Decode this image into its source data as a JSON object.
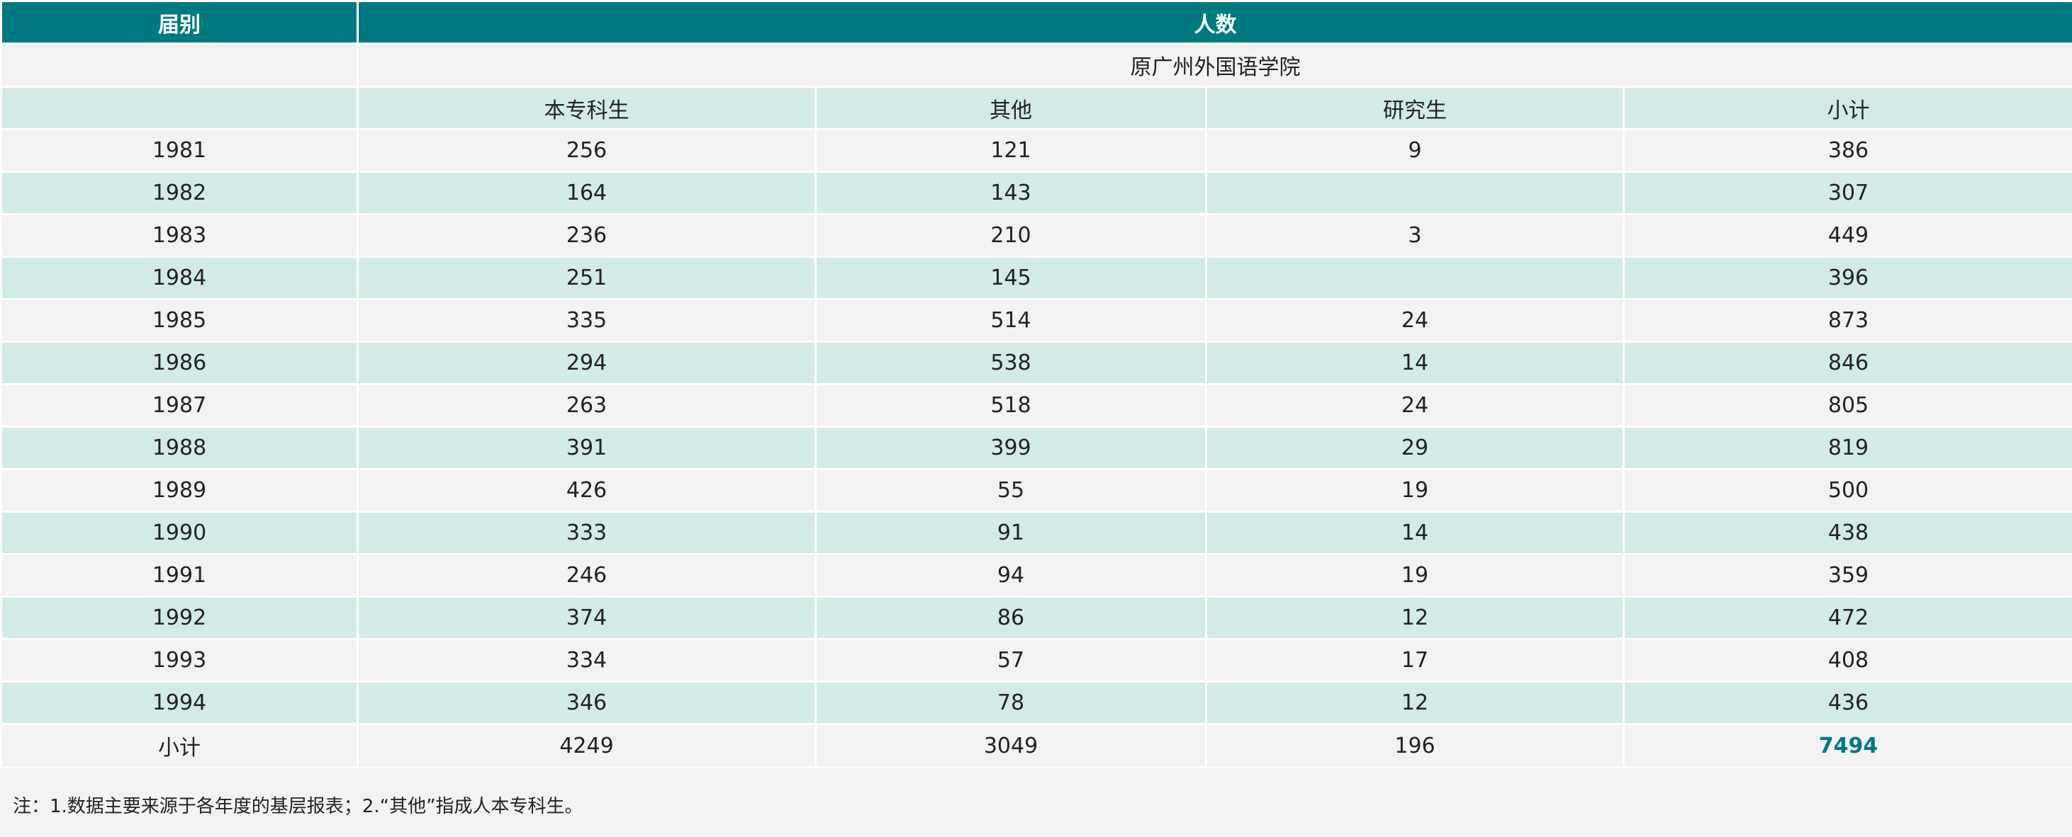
{
  "header": {
    "col_term": "届别",
    "col_count": "人数"
  },
  "band": {
    "school": "原广州外国语学院"
  },
  "subheader": {
    "undergrad": "本专科生",
    "other": "其他",
    "graduate": "研究生",
    "subtotal": "小计"
  },
  "rows": [
    {
      "year": "1981",
      "undergrad": "256",
      "other": "121",
      "graduate": "9",
      "subtotal": "386"
    },
    {
      "year": "1982",
      "undergrad": "164",
      "other": "143",
      "graduate": "",
      "subtotal": "307"
    },
    {
      "year": "1983",
      "undergrad": "236",
      "other": "210",
      "graduate": "3",
      "subtotal": "449"
    },
    {
      "year": "1984",
      "undergrad": "251",
      "other": "145",
      "graduate": "",
      "subtotal": "396"
    },
    {
      "year": "1985",
      "undergrad": "335",
      "other": "514",
      "graduate": "24",
      "subtotal": "873"
    },
    {
      "year": "1986",
      "undergrad": "294",
      "other": "538",
      "graduate": "14",
      "subtotal": "846"
    },
    {
      "year": "1987",
      "undergrad": "263",
      "other": "518",
      "graduate": "24",
      "subtotal": "805"
    },
    {
      "year": "1988",
      "undergrad": "391",
      "other": "399",
      "graduate": "29",
      "subtotal": "819"
    },
    {
      "year": "1989",
      "undergrad": "426",
      "other": "55",
      "graduate": "19",
      "subtotal": "500"
    },
    {
      "year": "1990",
      "undergrad": "333",
      "other": "91",
      "graduate": "14",
      "subtotal": "438"
    },
    {
      "year": "1991",
      "undergrad": "246",
      "other": "94",
      "graduate": "19",
      "subtotal": "359"
    },
    {
      "year": "1992",
      "undergrad": "374",
      "other": "86",
      "graduate": "12",
      "subtotal": "472"
    },
    {
      "year": "1993",
      "undergrad": "334",
      "other": "57",
      "graduate": "17",
      "subtotal": "408"
    },
    {
      "year": "1994",
      "undergrad": "346",
      "other": "78",
      "graduate": "12",
      "subtotal": "436"
    }
  ],
  "total": {
    "label": "小计",
    "undergrad": "4249",
    "other": "3049",
    "graduate": "196",
    "subtotal": "7494"
  },
  "note": "注：1.数据主要来源于各年度的基层报表；2.“其他”指成人本专科生。",
  "colors": {
    "header_bg": "#007a80",
    "band_light": "#f2f2f2",
    "band_mint": "#d2ebe6",
    "accent_text": "#007a80"
  }
}
